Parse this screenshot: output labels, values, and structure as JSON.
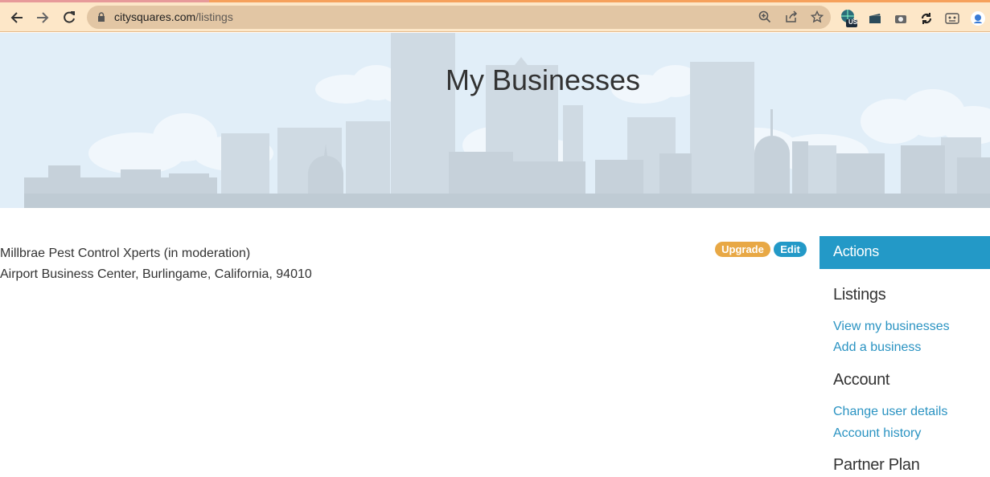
{
  "browser": {
    "url_domain": "citysquares.com",
    "url_path": "/listings",
    "extension_badge": "US"
  },
  "hero": {
    "title": "My Businesses"
  },
  "listing": {
    "name": "Millbrae Pest Control Xperts (in moderation)",
    "address": "Airport Business Center, Burlingame, California, 94010",
    "upgrade_label": "Upgrade",
    "edit_label": "Edit"
  },
  "sidebar": {
    "header": "Actions",
    "listings_heading": "Listings",
    "view_businesses": "View my businesses",
    "add_business": "Add a business",
    "account_heading": "Account",
    "change_user_details": "Change user details",
    "account_history": "Account history",
    "partner_plan_heading": "Partner Plan"
  },
  "colors": {
    "accent_blue": "#2399c7",
    "upgrade_orange": "#e8a845",
    "link_blue": "#2a93c2"
  }
}
